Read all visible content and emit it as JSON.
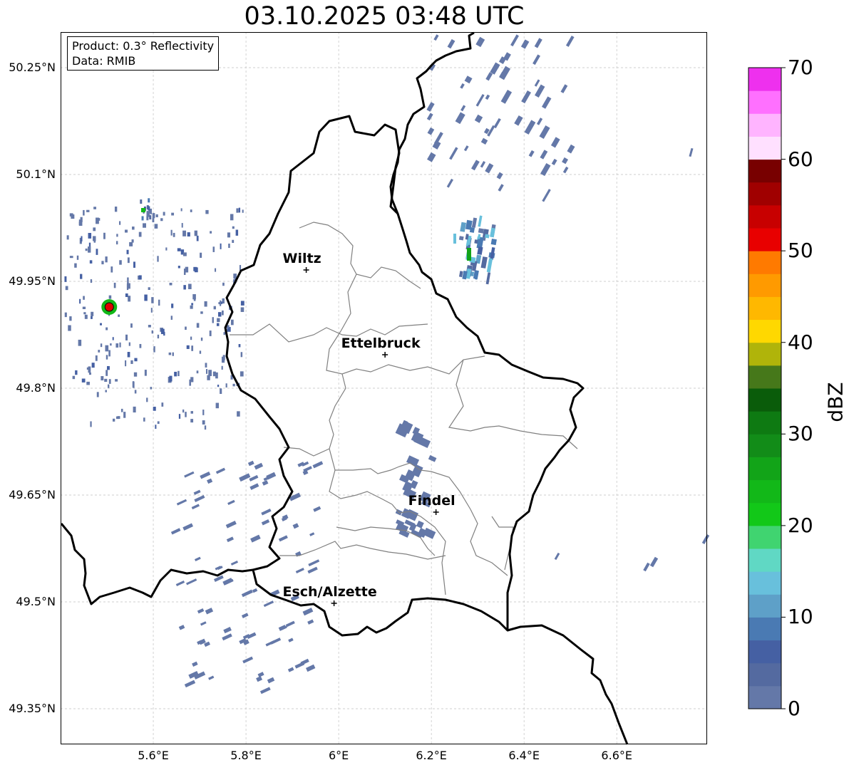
{
  "title": "03.10.2025 03:48 UTC",
  "info": {
    "product": "Product: 0.3° Reflectivity",
    "data": "Data: RMIB"
  },
  "lat_ticks": [
    "50.25°N",
    "50.1°N",
    "49.95°N",
    "49.8°N",
    "49.65°N",
    "49.5°N",
    "49.35°N"
  ],
  "lon_ticks": [
    "5.6°E",
    "5.8°E",
    "6°E",
    "6.2°E",
    "6.4°E",
    "6.6°E"
  ],
  "cities": [
    {
      "name": "Wiltz",
      "lon": 5.93,
      "lat": 49.966
    },
    {
      "name": "Ettelbruck",
      "lon": 6.1,
      "lat": 49.847
    },
    {
      "name": "Findel",
      "lon": 6.21,
      "lat": 49.626
    },
    {
      "name": "Esch/Alzette",
      "lon": 5.99,
      "lat": 49.498
    }
  ],
  "radar_site": {
    "lon": 5.505,
    "lat": 49.914
  },
  "extent": {
    "lon_min": 5.4,
    "lon_max": 6.795,
    "lat_min": 49.3,
    "lat_max": 50.3
  },
  "colorbar": {
    "label": "dBZ",
    "ticks": [
      "0",
      "10",
      "20",
      "30",
      "40",
      "50",
      "60",
      "70"
    ],
    "min": 0,
    "max": 70,
    "colors": [
      "#6478a8",
      "#546aa0",
      "#4560a3",
      "#4a7ab3",
      "#5ea0c8",
      "#68c0dc",
      "#60d8c4",
      "#40d470",
      "#12c818",
      "#12b818",
      "#12a418",
      "#128c18",
      "#0e7a12",
      "#0a5c0a",
      "#46781a",
      "#b0b40a",
      "#ffd800",
      "#ffb800",
      "#ff9a00",
      "#ff7a00",
      "#e80000",
      "#c80000",
      "#a00000",
      "#780000",
      "#ffe0ff",
      "#ffb4ff",
      "#ff70ff",
      "#ee30ee"
    ]
  },
  "colors": {
    "border": "#000000",
    "canton": "#808080",
    "grid": "#c0c0c0",
    "echo": "#6478a8"
  }
}
